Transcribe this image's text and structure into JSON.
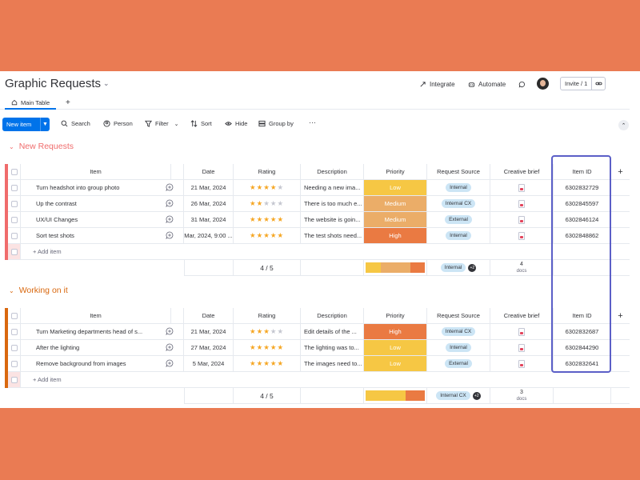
{
  "header": {
    "title": "Graphic Requests",
    "integrate": "Integrate",
    "automate": "Automate",
    "invite": "Invite / 1"
  },
  "tabs": {
    "main": "Main Table",
    "add": "+"
  },
  "toolbar": {
    "new_item": "New item",
    "search": "Search",
    "person": "Person",
    "filter": "Filter",
    "sort": "Sort",
    "hide": "Hide",
    "group_by": "Group by",
    "more": "···"
  },
  "columns": {
    "item": "Item",
    "date": "Date",
    "rating": "Rating",
    "description": "Description",
    "priority": "Priority",
    "request_source": "Request Source",
    "creative_brief": "Creative brief",
    "item_id": "Item ID",
    "add": "+"
  },
  "colors": {
    "accent": "#0073ea",
    "low": "#f6c744",
    "medium": "#ebad68",
    "high": "#ea7a42",
    "group1": "#f06c6c",
    "group2": "#d9680f",
    "highlight": "#5b5fc7"
  },
  "groups": [
    {
      "title": "New Requests",
      "add_item": "+ Add item",
      "rows": [
        {
          "item": "Turn headshot into group photo",
          "date": "21 Mar, 2024",
          "rating": 4,
          "description": "Needing a new ima...",
          "priority": "Low",
          "source": "Internal",
          "item_id": "6302832729"
        },
        {
          "item": "Up the contrast",
          "date": "26 Mar, 2024",
          "rating": 2,
          "description": "There is too much e...",
          "priority": "Medium",
          "source": "Internal CX",
          "item_id": "6302845597"
        },
        {
          "item": "UX/UI Changes",
          "date": "31 Mar, 2024",
          "rating": 5,
          "description": "The website is goin...",
          "priority": "Medium",
          "source": "External",
          "item_id": "6302846124"
        },
        {
          "item": "Sort test shots",
          "date": "Mar, 2024, 9:00 ...",
          "rating": 5,
          "description": "The test shots need...",
          "priority": "High",
          "source": "Internal",
          "item_id": "6302848862"
        }
      ],
      "summary": {
        "rating": "4 / 5",
        "source": "Internal",
        "source_more": "+2",
        "docs_count": "4",
        "docs_label": "docs",
        "priority_share": {
          "low": 25,
          "medium": 50,
          "high": 25
        }
      }
    },
    {
      "title": "Working on it",
      "add_item": "+ Add item",
      "rows": [
        {
          "item": "Turn Marketing departments head of s...",
          "date": "21 Mar, 2024",
          "rating": 3,
          "description": "Edit details of the ...",
          "priority": "High",
          "source": "Internal CX",
          "item_id": "6302832687"
        },
        {
          "item": "After the lighting",
          "date": "27 Mar, 2024",
          "rating": 5,
          "description": "The lighting was to...",
          "priority": "Low",
          "source": "Internal",
          "item_id": "6302844290"
        },
        {
          "item": "Remove background from images",
          "date": "5 Mar, 2024",
          "rating": 5,
          "description": "The images need to...",
          "priority": "Low",
          "source": "External",
          "item_id": "6302832641"
        }
      ],
      "summary": {
        "rating": "4 / 5",
        "source": "Internal CX",
        "source_more": "+2",
        "docs_count": "3",
        "docs_label": "docs",
        "priority_share": {
          "low": 67,
          "medium": 0,
          "high": 33
        }
      }
    }
  ]
}
